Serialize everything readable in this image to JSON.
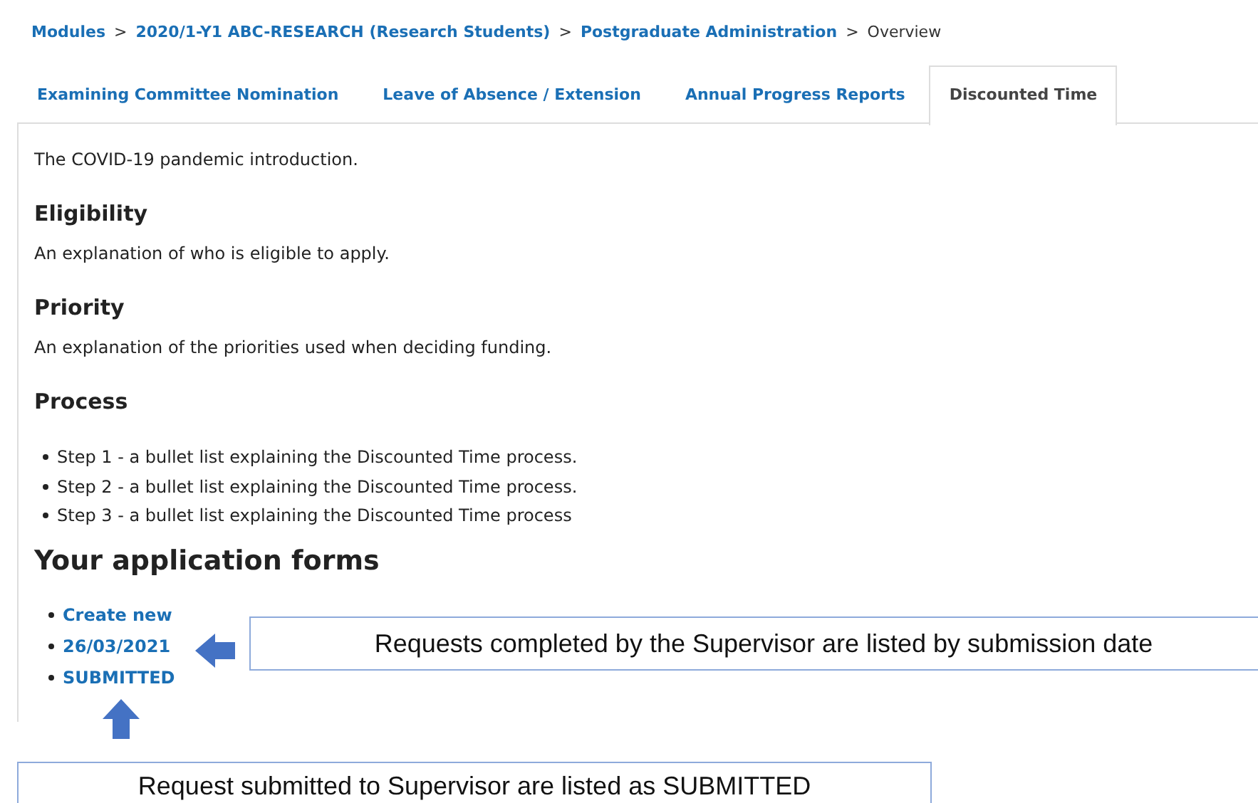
{
  "breadcrumb_separator": ">",
  "breadcrumb": [
    {
      "label": "Modules",
      "kind": "link"
    },
    {
      "label": "2020/1-Y1 ABC-RESEARCH (Research Students)",
      "kind": "link"
    },
    {
      "label": "Postgraduate Administration",
      "kind": "link"
    },
    {
      "label": "Overview",
      "kind": "current"
    }
  ],
  "tabs": [
    {
      "label": "Examining Committee Nomination",
      "selected": false
    },
    {
      "label": "Leave of Absence / Extension",
      "selected": false
    },
    {
      "label": "Annual Progress Reports",
      "selected": false
    },
    {
      "label": "Discounted Time",
      "selected": true
    }
  ],
  "intro": "The COVID-19 pandemic introduction.",
  "sections": [
    {
      "heading": "Eligibility",
      "text": "An explanation of who is eligible to apply."
    },
    {
      "heading": "Priority",
      "text": "An explanation of the priorities used when deciding funding."
    },
    {
      "heading": "Process",
      "bullets": [
        "Step 1 - a bullet list explaining the Discounted Time process.",
        "Step 2 - a bullet list explaining the Discounted Time process.",
        "Step 3 - a bullet list explaining the Discounted Time process"
      ]
    }
  ],
  "application_forms": {
    "heading": "Your application forms",
    "links": [
      "Create new",
      "26/03/2021",
      "SUBMITTED"
    ]
  },
  "annotations": [
    {
      "text": "Requests completed by the Supervisor are listed by submission date",
      "kind": "left"
    },
    {
      "text": "Request submitted to Supervisor are listed as SUBMITTED",
      "kind": "up"
    }
  ]
}
